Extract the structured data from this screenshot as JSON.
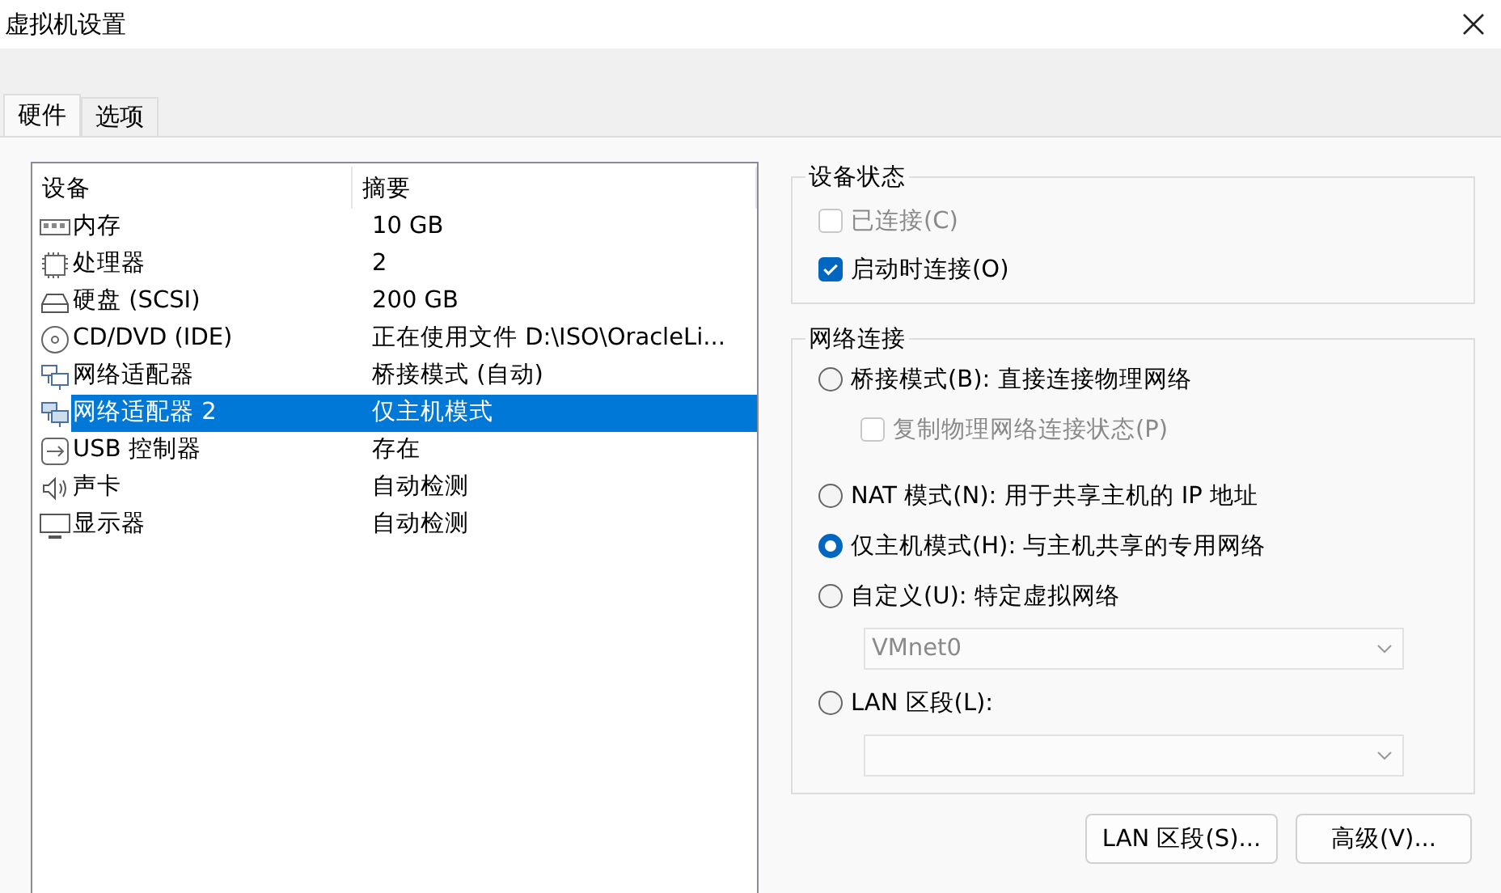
{
  "window": {
    "title": "虚拟机设置"
  },
  "tabs": [
    {
      "label": "硬件",
      "selected": true
    },
    {
      "label": "选项",
      "selected": false
    }
  ],
  "device_table": {
    "columns": [
      "设备",
      "摘要"
    ],
    "rows": [
      {
        "kind": "memory",
        "device": "内存",
        "summary": "10 GB",
        "selected": false
      },
      {
        "kind": "cpu",
        "device": "处理器",
        "summary": "2",
        "selected": false
      },
      {
        "kind": "disk",
        "device": "硬盘 (SCSI)",
        "summary": "200 GB",
        "selected": false
      },
      {
        "kind": "cd",
        "device": "CD/DVD (IDE)",
        "summary": "正在使用文件 D:\\ISO\\OracleLi...",
        "selected": false
      },
      {
        "kind": "network",
        "device": "网络适配器",
        "summary": "桥接模式 (自动)",
        "selected": false
      },
      {
        "kind": "network",
        "device": "网络适配器 2",
        "summary": "仅主机模式",
        "selected": true
      },
      {
        "kind": "usb",
        "device": "USB 控制器",
        "summary": "存在",
        "selected": false
      },
      {
        "kind": "sound",
        "device": "声卡",
        "summary": "自动检测",
        "selected": false
      },
      {
        "kind": "display",
        "device": "显示器",
        "summary": "自动检测",
        "selected": false
      }
    ]
  },
  "device_status": {
    "title": "设备状态",
    "options": [
      {
        "label": "已连接(C)",
        "checked": false,
        "disabled": true
      },
      {
        "label": "启动时连接(O)",
        "checked": true,
        "disabled": false
      }
    ]
  },
  "network_connection": {
    "title": "网络连接",
    "items": [
      {
        "kind": "radio",
        "label": "桥接模式(B): 直接连接物理网络",
        "selected": false
      },
      {
        "kind": "checkbox",
        "label": "复制物理网络连接状态(P)",
        "checked": false,
        "disabled": true
      },
      {
        "kind": "radio",
        "label": "NAT 模式(N): 用于共享主机的 IP 地址",
        "selected": false
      },
      {
        "kind": "radio",
        "label": "仅主机模式(H): 与主机共享的专用网络",
        "selected": true
      },
      {
        "kind": "radio",
        "label": "自定义(U): 特定虚拟网络",
        "selected": false
      },
      {
        "kind": "dropdown",
        "value": "VMnet0",
        "disabled": true
      },
      {
        "kind": "radio",
        "label": "LAN 区段(L):",
        "selected": false
      },
      {
        "kind": "dropdown",
        "disabled": true
      }
    ]
  },
  "buttons": [
    "LAN 区段(S)...",
    "高级(V)..."
  ]
}
